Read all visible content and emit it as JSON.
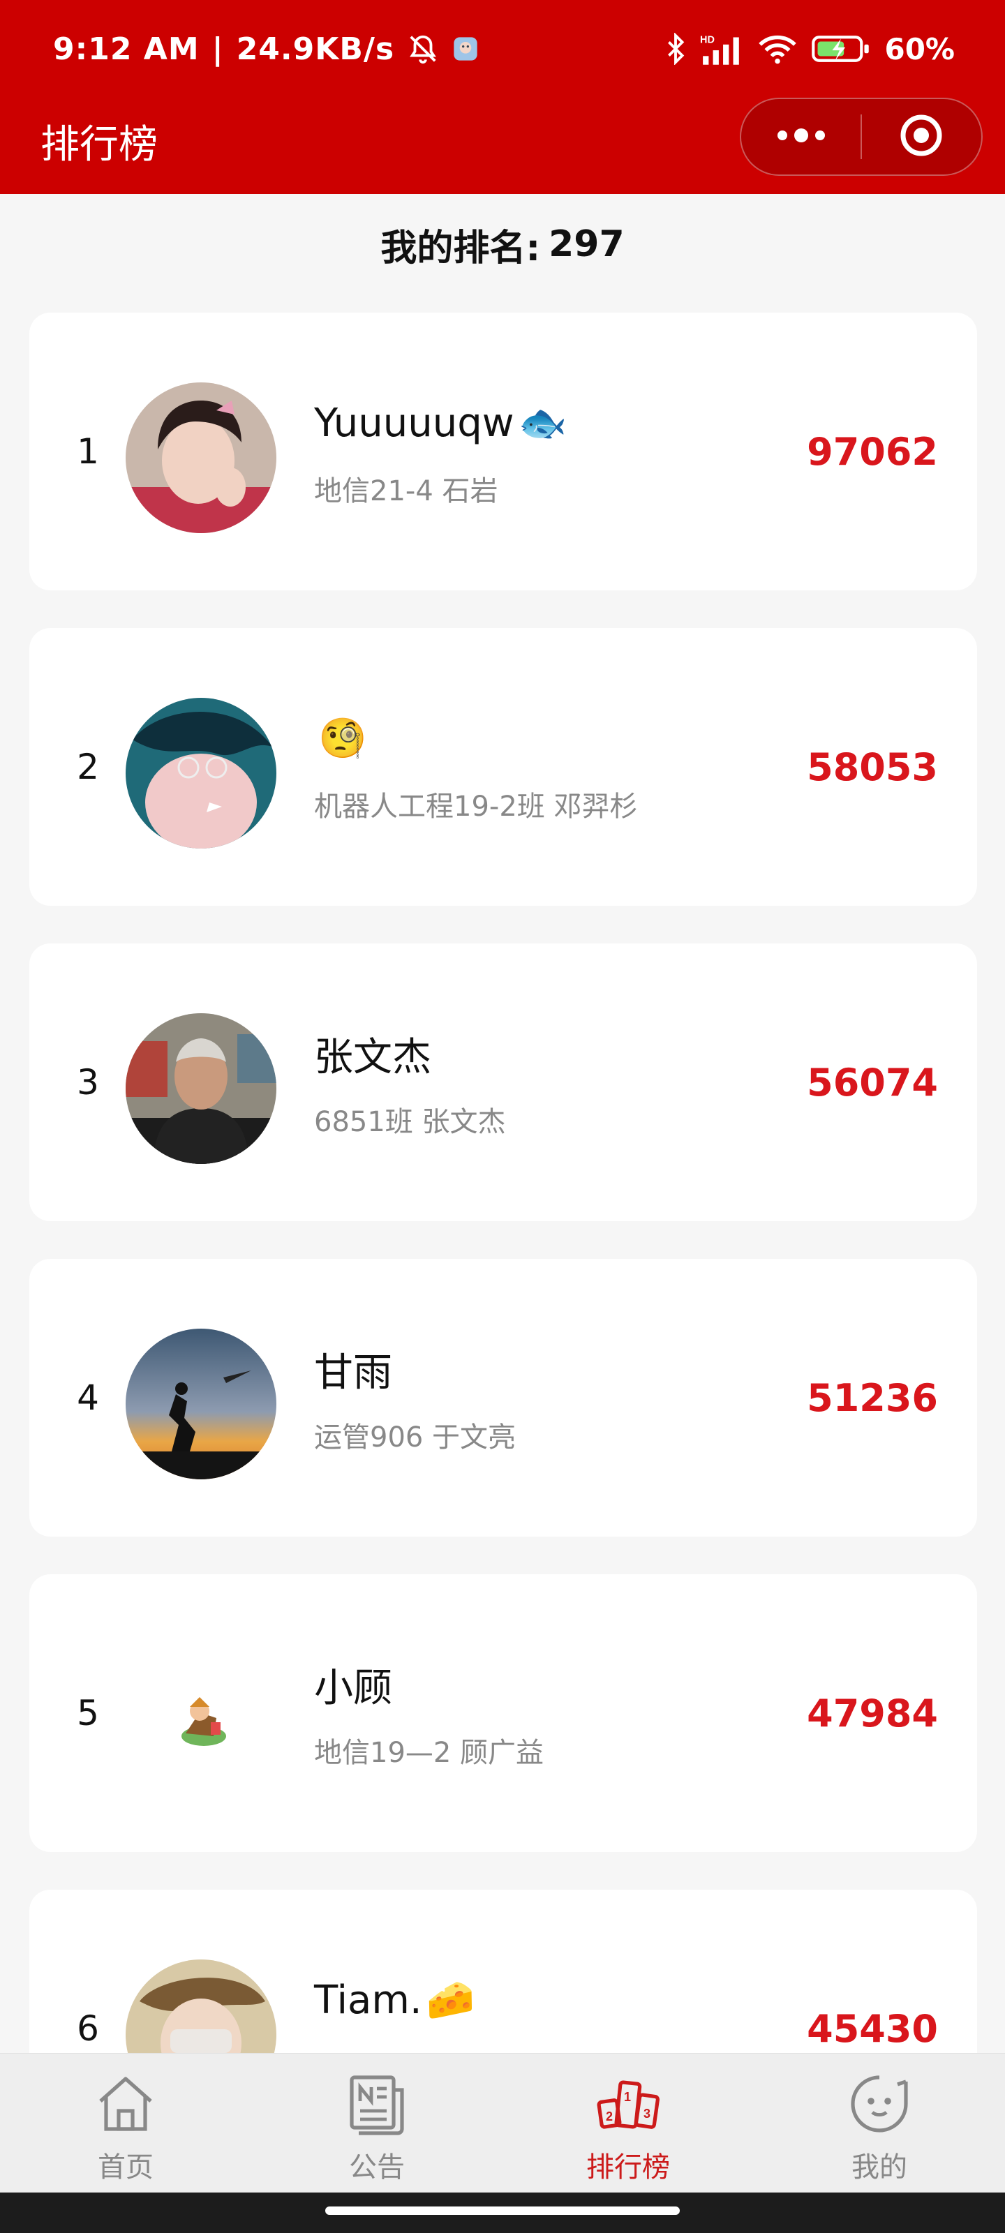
{
  "status_bar": {
    "time": "9:12 AM",
    "separator": "|",
    "net_speed": "24.9KB/s",
    "battery_percent": "60%",
    "icons": [
      "mute-bell-icon",
      "app-notification-icon",
      "bluetooth-icon",
      "hd-signal-icon",
      "wifi-icon",
      "battery-charging-icon"
    ]
  },
  "header": {
    "title": "排行榜",
    "capsule_more_icon": "more-dots-icon",
    "capsule_close_icon": "target-close-icon",
    "background_color": "#cc0000"
  },
  "my_rank": {
    "label": "我的排名:",
    "value": "297"
  },
  "ranking": [
    {
      "rank": "1",
      "name": "Yuuuuuqw",
      "name_emoji": "🐟",
      "class_info": "地信21-4 石岩",
      "score": "97062"
    },
    {
      "rank": "2",
      "name": "",
      "name_emoji": "🧐",
      "class_info": "机器人工程19-2班 邓羿杉",
      "score": "58053"
    },
    {
      "rank": "3",
      "name": "张文杰",
      "name_emoji": "",
      "class_info": "6851班 张文杰",
      "score": "56074"
    },
    {
      "rank": "4",
      "name": "甘雨",
      "name_emoji": "",
      "class_info": "运管906 于文亮",
      "score": "51236"
    },
    {
      "rank": "5",
      "name": "小顾",
      "name_emoji": "",
      "class_info": "地信19—2 顾广益",
      "score": "47984"
    },
    {
      "rank": "6",
      "name": "Tiam.",
      "name_emoji": "🧀",
      "class_info": "",
      "score": "45430"
    }
  ],
  "tabbar": {
    "tabs": [
      {
        "label": "首页",
        "icon": "home-icon",
        "active": false
      },
      {
        "label": "公告",
        "icon": "news-icon",
        "active": false
      },
      {
        "label": "排行榜",
        "icon": "podium-icon",
        "active": true
      },
      {
        "label": "我的",
        "icon": "face-icon",
        "active": false
      }
    ],
    "active_color": "#cc1a1a",
    "inactive_color": "#888888"
  },
  "colors": {
    "score": "#d9161c",
    "accent": "#cc0000"
  }
}
